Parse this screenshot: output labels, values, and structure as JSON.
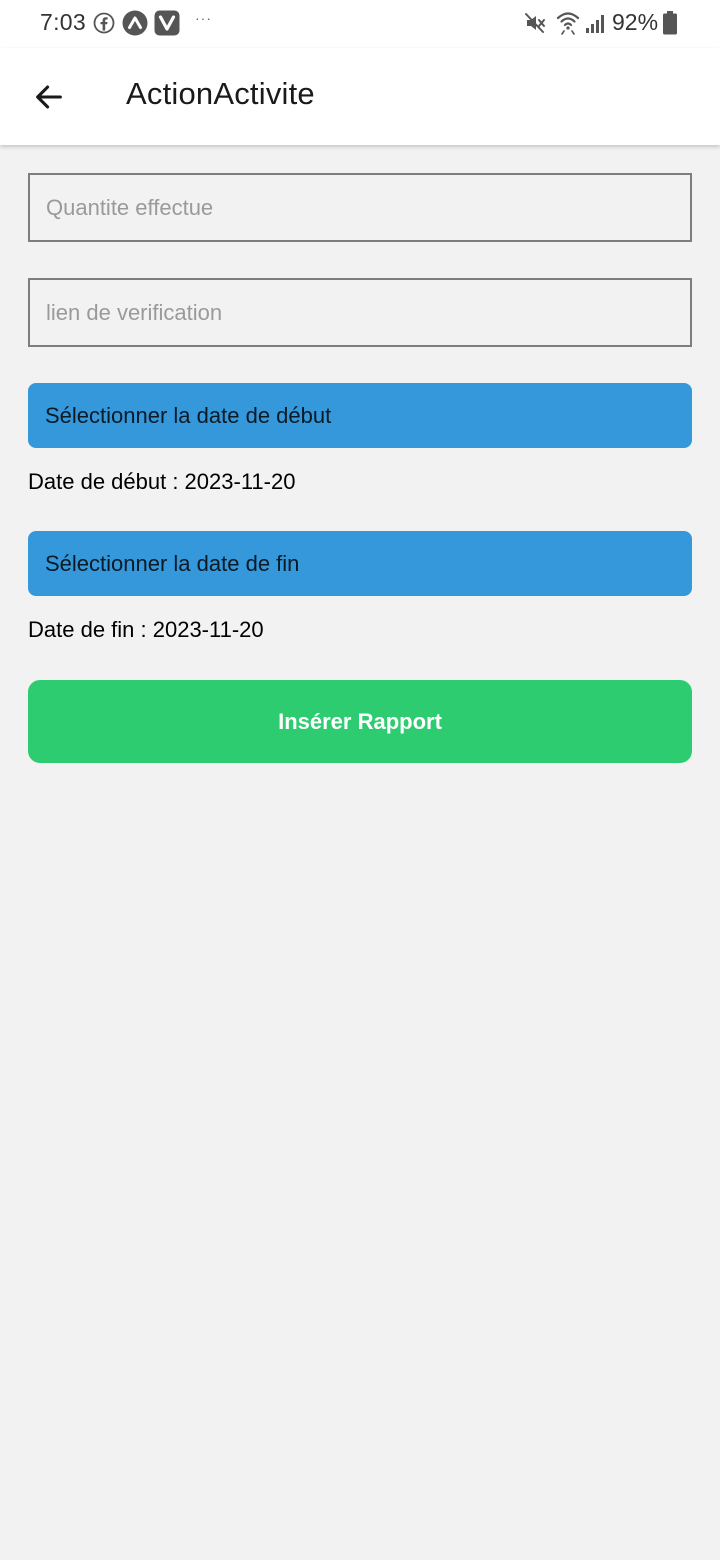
{
  "status_bar": {
    "time": "7:03",
    "more_indicator": "···",
    "battery_percent": "92%",
    "icons": [
      "facebook-icon",
      "app-a-icon",
      "app-v-icon",
      "mute-icon",
      "wifi-icon",
      "signal-icon",
      "battery-icon"
    ]
  },
  "app_bar": {
    "title": "ActionActivite",
    "back_icon": "arrow-left-icon"
  },
  "form": {
    "quantity_placeholder": "Quantite effectue",
    "quantity_value": "",
    "link_placeholder": "lien de verification",
    "link_value": "",
    "start_date_button": "Sélectionner la date de début",
    "start_date_text": "Date de début : 2023-11-20",
    "end_date_button": "Sélectionner la date de fin",
    "end_date_text": "Date de fin : 2023-11-20",
    "submit_label": "Insérer Rapport"
  },
  "colors": {
    "date_button": "#3498db",
    "submit_button": "#2ecc71",
    "background": "#f2f2f2",
    "app_bar": "#ffffff"
  }
}
